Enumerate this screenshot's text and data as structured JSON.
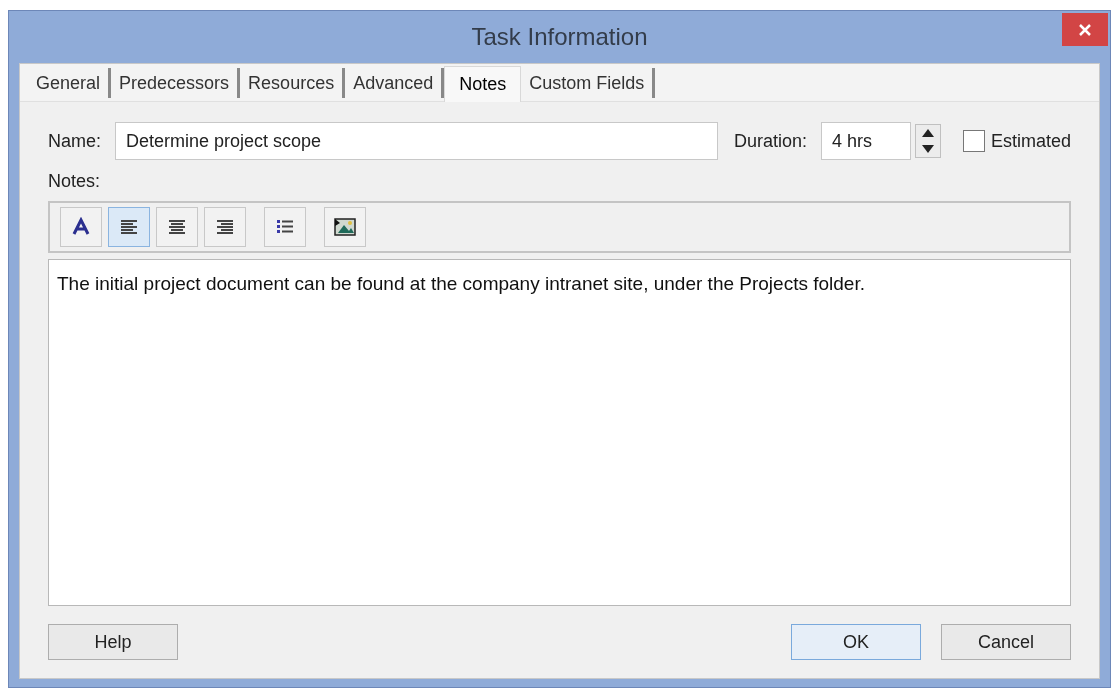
{
  "window": {
    "title": "Task Information"
  },
  "tabs": [
    {
      "label": "General",
      "selected": false
    },
    {
      "label": "Predecessors",
      "selected": false
    },
    {
      "label": "Resources",
      "selected": false
    },
    {
      "label": "Advanced",
      "selected": false
    },
    {
      "label": "Notes",
      "selected": true
    },
    {
      "label": "Custom Fields",
      "selected": false
    }
  ],
  "name_field": {
    "label": "Name:",
    "value": "Determine project scope"
  },
  "duration_field": {
    "label": "Duration:",
    "value": "4 hrs"
  },
  "estimated": {
    "label": "Estimated",
    "checked": false
  },
  "notes": {
    "label": "Notes:",
    "text": "The initial project document can be found at the company intranet site, under the Projects folder."
  },
  "toolbar": [
    {
      "kind": "font",
      "selected": false
    },
    {
      "kind": "align-left",
      "selected": true
    },
    {
      "kind": "align-center",
      "selected": false
    },
    {
      "kind": "align-right",
      "selected": false
    },
    {
      "kind": "bullets",
      "selected": false
    },
    {
      "kind": "picture",
      "selected": false
    }
  ],
  "buttons": [
    {
      "label": "Help",
      "default": false
    },
    {
      "label": "OK",
      "default": true
    },
    {
      "label": "Cancel",
      "default": false
    }
  ]
}
